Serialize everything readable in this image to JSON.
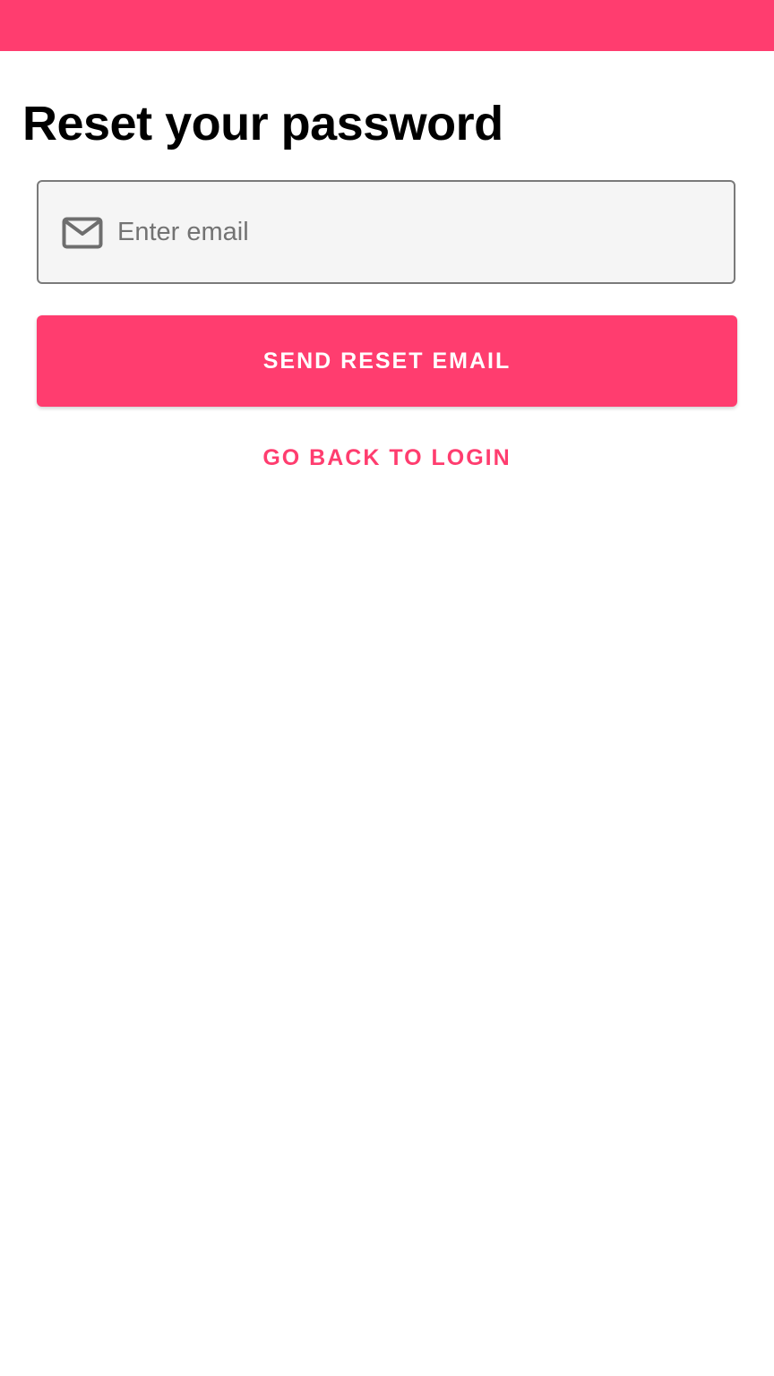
{
  "theme": {
    "accent": "#ff3d6f",
    "field_background": "#f5f5f5",
    "field_border": "#7a7a7a",
    "placeholder_color": "#737373"
  },
  "page": {
    "title": "Reset your password"
  },
  "email_field": {
    "icon": "mail-icon",
    "placeholder": "Enter email",
    "value": ""
  },
  "actions": {
    "send_label": "SEND RESET EMAIL",
    "back_label": "GO BACK TO LOGIN"
  }
}
